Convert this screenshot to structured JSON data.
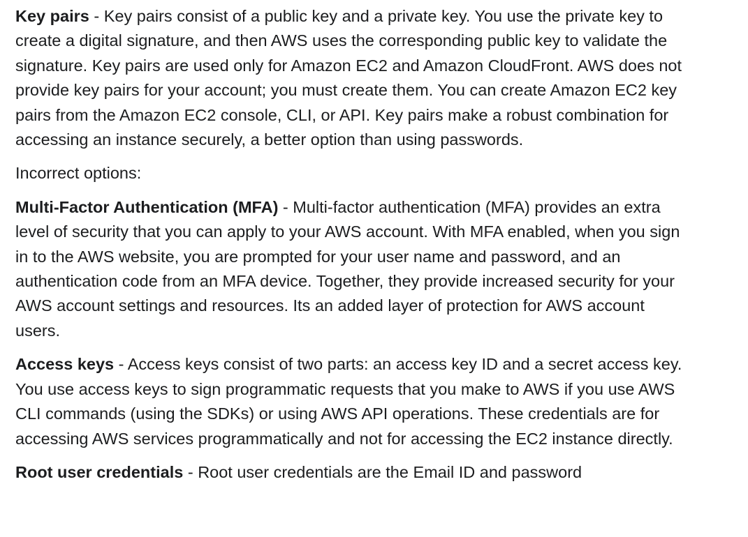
{
  "explanation": {
    "key_pairs": {
      "term": "Key pairs",
      "separator": " - ",
      "text": "Key pairs consist of a public key and a private key. You use the private key to create a digital signature, and then AWS uses the corresponding public key to validate the signature. Key pairs are used only for Amazon EC2 and Amazon CloudFront. AWS does not provide key pairs for your account; you must create them. You can create Amazon EC2 key pairs from the Amazon EC2 console, CLI, or API. Key pairs make a robust combination for accessing an instance securely, a better option than using passwords."
    },
    "incorrect_heading": "Incorrect options:",
    "mfa": {
      "term": "Multi-Factor Authentication (MFA)",
      "separator": " - ",
      "text": "Multi-factor authentication (MFA) provides an extra level of security that you can apply to your AWS account. With MFA enabled, when you sign in to the AWS website, you are prompted for your user name and password, and an authentication code from an MFA device. Together, they provide increased security for your AWS account settings and resources. Its an added layer of protection for AWS account users."
    },
    "access_keys": {
      "term": "Access keys",
      "separator": " - ",
      "text": "Access keys consist of two parts: an access key ID and a secret access key. You use access keys to sign programmatic requests that you make to AWS if you use AWS CLI commands (using the SDKs) or using AWS API operations. These credentials are for accessing AWS services programmatically and not for accessing the EC2 instance directly."
    },
    "root_user": {
      "term": "Root user credentials",
      "separator": " - ",
      "text": "Root user credentials are the Email ID and password"
    }
  }
}
